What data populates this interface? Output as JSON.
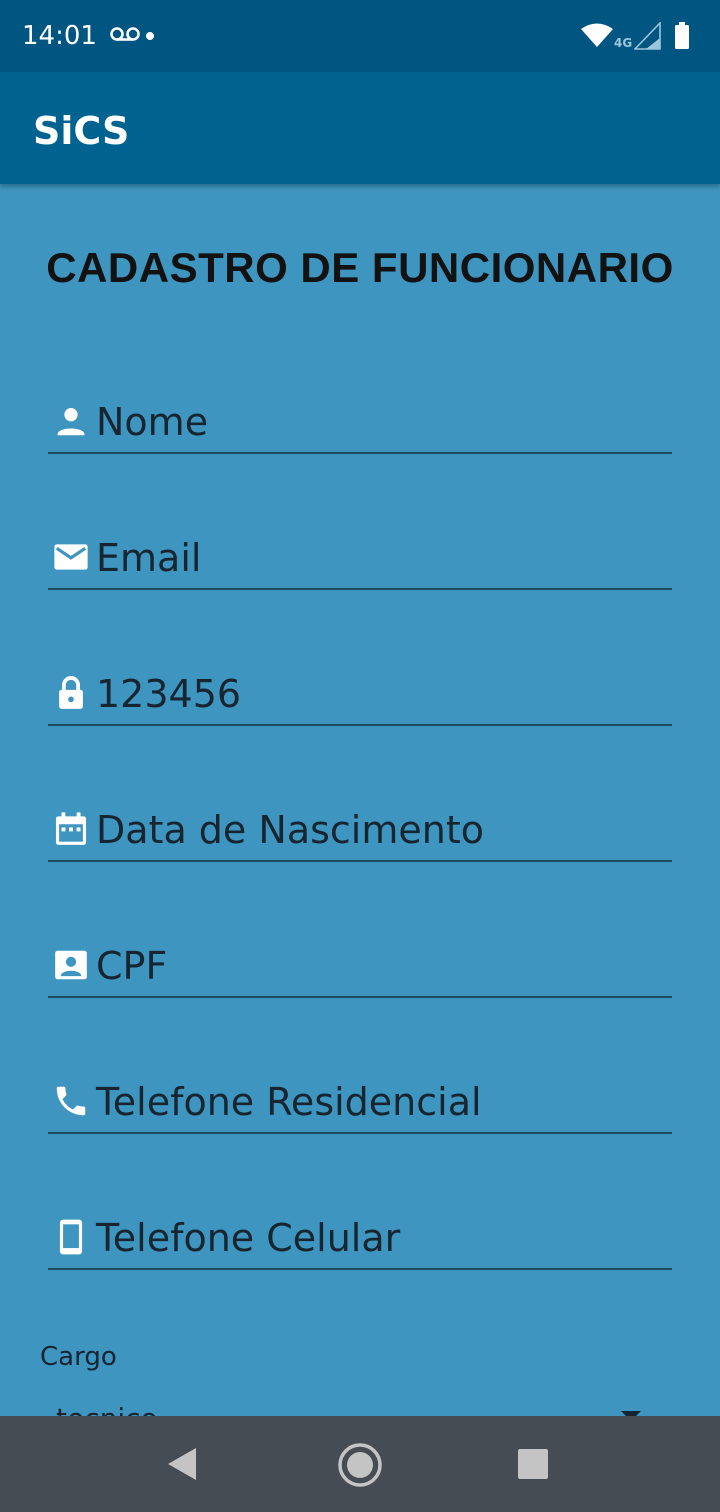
{
  "status_bar": {
    "time": "14:01",
    "network": "4G"
  },
  "app_bar": {
    "title": "SiCS"
  },
  "page": {
    "title": "CADASTRO DE FUNCIONARIO"
  },
  "fields": {
    "nome": {
      "hint": "Nome",
      "icon": "person-icon"
    },
    "email": {
      "hint": "Email",
      "icon": "mail-icon"
    },
    "senha": {
      "value": "123456",
      "icon": "lock-icon"
    },
    "nascimento": {
      "hint": "Data de Nascimento",
      "icon": "calendar-icon"
    },
    "cpf": {
      "hint": "CPF",
      "icon": "contact-card-icon"
    },
    "tel_residencial": {
      "hint": "Telefone Residencial",
      "icon": "phone-icon"
    },
    "tel_celular": {
      "hint": "Telefone Celular",
      "icon": "smartphone-icon"
    }
  },
  "cargo": {
    "label": "Cargo",
    "selected": "tecnico"
  },
  "colors": {
    "background": "#3e95bf",
    "app_bar": "#00628f",
    "status_bar": "#005681",
    "nav_bar": "#454c53"
  }
}
